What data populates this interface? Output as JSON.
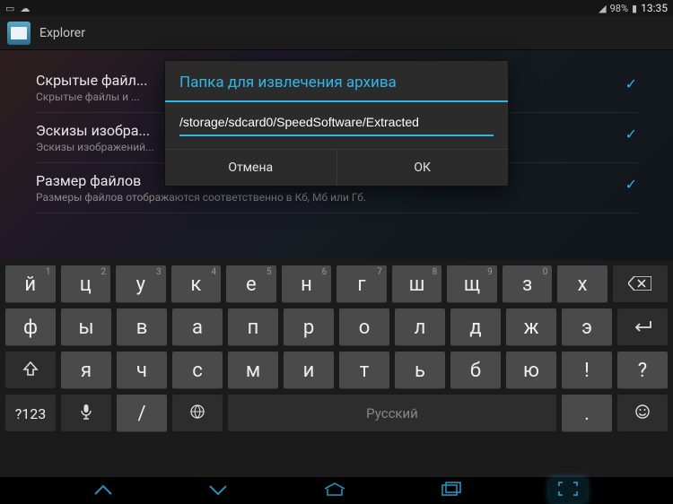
{
  "status": {
    "battery_pct": "98%",
    "time": "13:35"
  },
  "app": {
    "title": "Explorer"
  },
  "settings": [
    {
      "title": "Скрытые файл...",
      "sub": "Скрытые файлы и ..."
    },
    {
      "title": "Эскизы изобра...",
      "sub": "Эскизы изображений..."
    },
    {
      "title": "Размер файлов",
      "sub": "Размеры файлов отображаются соответственно в Кб, Мб или Гб."
    }
  ],
  "dialog": {
    "title": "Папка для извлечения архива",
    "value": "/storage/sdcard0/SpeedSoftware/Extracted",
    "cancel": "Отмена",
    "ok": "ОК"
  },
  "keyboard": {
    "row1": [
      "й",
      "ц",
      "у",
      "к",
      "е",
      "н",
      "г",
      "ш",
      "щ",
      "з",
      "х"
    ],
    "hints1": [
      "1",
      "2",
      "3",
      "4",
      "5",
      "6",
      "7",
      "8",
      "9",
      "0",
      ""
    ],
    "row2": [
      "ф",
      "ы",
      "в",
      "а",
      "п",
      "р",
      "о",
      "л",
      "д",
      "ж",
      "э"
    ],
    "row3": [
      "я",
      "ч",
      "с",
      "м",
      "и",
      "т",
      "ь",
      "б",
      "ю",
      "!",
      "?"
    ],
    "sym": "?123",
    "slash": "/",
    "space": "Русский",
    "dot": "."
  },
  "colors": {
    "accent": "#33b5e5"
  }
}
